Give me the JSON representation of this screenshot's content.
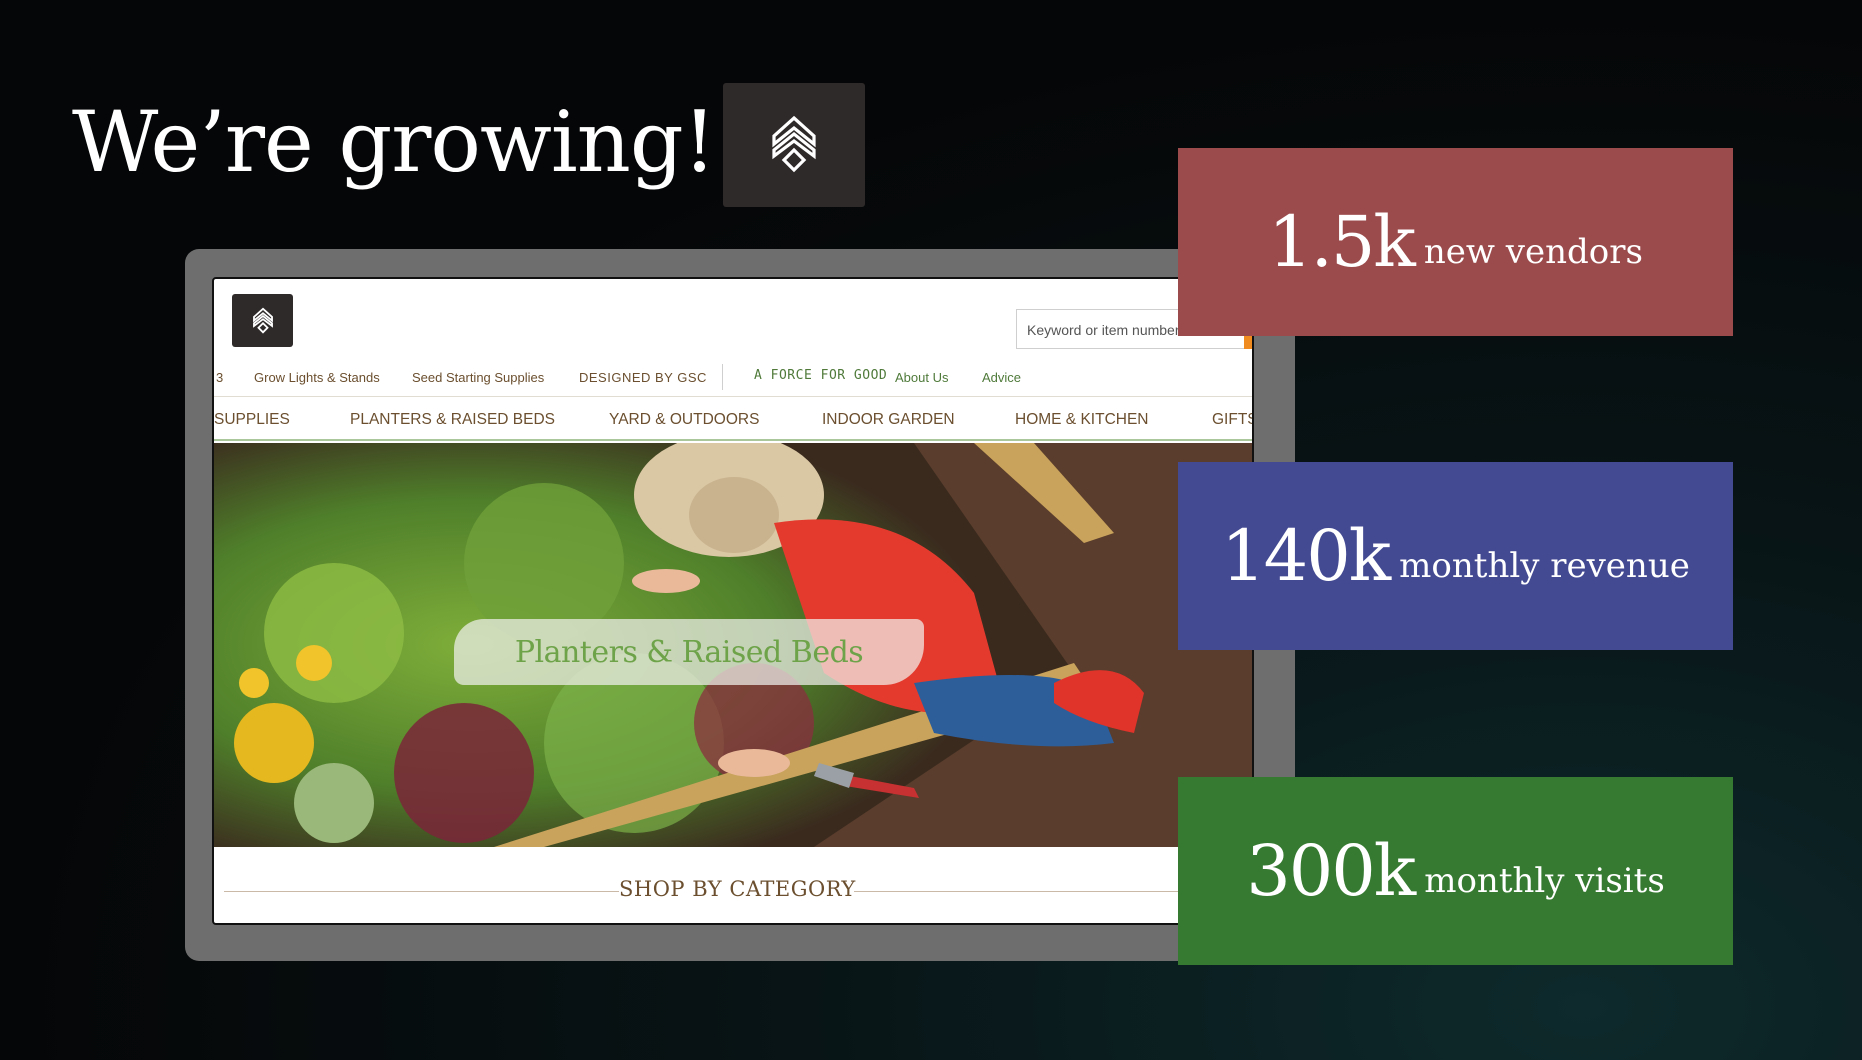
{
  "headline": "We’re growing!",
  "logo_icon": "leaf-logo-icon",
  "website": {
    "search": {
      "placeholder": "Keyword or item number"
    },
    "utility_nav": {
      "truncated_prefix": "3",
      "items": [
        "Grow Lights & Stands",
        "Seed Starting Supplies",
        "DESIGNED BY GSC"
      ],
      "tagline": "A FORCE FOR GOOD",
      "links": [
        "About Us",
        "Advice"
      ]
    },
    "main_nav": [
      "SUPPLIES",
      "PLANTERS & RAISED BEDS",
      "YARD & OUTDOORS",
      "INDOOR GARDEN",
      "HOME & KITCHEN",
      "GIFTS"
    ],
    "hero_label": "Planters & Raised Beds",
    "section_title": "SHOP BY CATEGORY"
  },
  "stats": [
    {
      "value": "1.5k",
      "label": "new vendors",
      "color": "#9c4b4c"
    },
    {
      "value": "140k",
      "label": "monthly revenue",
      "color": "#434a92"
    },
    {
      "value": "300k",
      "label": "monthly visits",
      "color": "#367a31"
    }
  ]
}
